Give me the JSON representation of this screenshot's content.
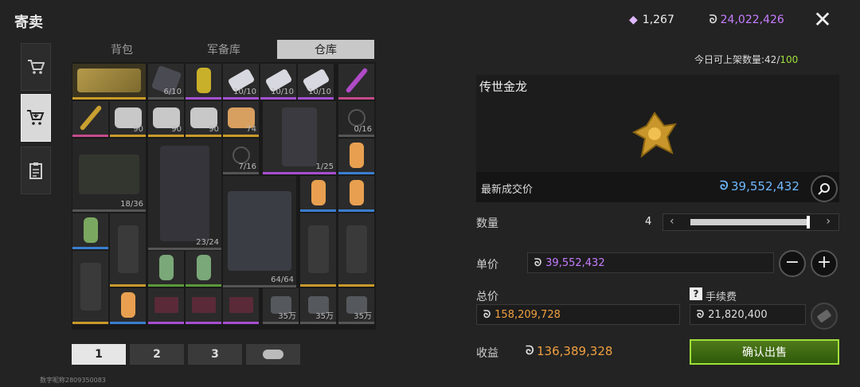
{
  "header": {
    "title": "寄卖",
    "diamonds": "1,267",
    "coins": "24,022,426",
    "daily_limit_label": "今日可上架数量:",
    "daily_used": "42",
    "daily_sep": "/",
    "daily_max": "100"
  },
  "tabs": [
    "背包",
    "军备库",
    "仓库"
  ],
  "items": [
    {
      "count": ""
    },
    {
      "count": "6/10"
    },
    {
      "count": ""
    },
    {
      "count": "10/10"
    },
    {
      "count": "10/10"
    },
    {
      "count": "10/10"
    },
    {
      "count": ""
    },
    {
      "count": ""
    },
    {
      "count": "90"
    },
    {
      "count": "90"
    },
    {
      "count": "90"
    },
    {
      "count": "74"
    },
    {
      "count": "1/25"
    },
    {
      "count": "0/16"
    },
    {
      "count": "7/16"
    },
    {
      "count": "18/36"
    },
    {
      "count": "23/24"
    },
    {
      "count": ""
    },
    {
      "count": "64/64"
    },
    {
      "count": "35万"
    },
    {
      "count": "35万"
    },
    {
      "count": "35万"
    }
  ],
  "pages": [
    "1",
    "2",
    "3"
  ],
  "footer": "数字昵称2809350083",
  "detail": {
    "item_name": "传世金龙",
    "latest_price_label": "最新成交价",
    "latest_price": "39,552,432",
    "quantity_label": "数量",
    "quantity": "4",
    "unit_price_label": "单价",
    "unit_price": "39,552,432",
    "total_label": "总价",
    "total": "158,209,728",
    "fee_label": "手续费",
    "fee_help": "?",
    "fee": "21,820,400",
    "income_label": "收益",
    "income": "136,389,328",
    "confirm_label": "确认出售"
  },
  "colors": {
    "coin_purple": "#c77dff",
    "price_blue": "#6fb8ff",
    "total_orange": "#f0a040",
    "income_orange": "#f0a040",
    "accent_green": "#9fe03a"
  }
}
